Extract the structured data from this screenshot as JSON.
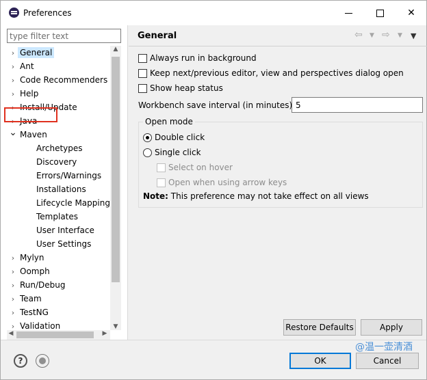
{
  "window": {
    "title": "Preferences"
  },
  "filter": {
    "placeholder": "type filter text"
  },
  "tree": {
    "items": [
      {
        "label": "General",
        "level": 0,
        "state": "collapsed",
        "selected": true
      },
      {
        "label": "Ant",
        "level": 0,
        "state": "collapsed"
      },
      {
        "label": "Code Recommenders",
        "level": 0,
        "state": "collapsed"
      },
      {
        "label": "Help",
        "level": 0,
        "state": "collapsed"
      },
      {
        "label": "Install/Update",
        "level": 0,
        "state": "collapsed"
      },
      {
        "label": "Java",
        "level": 0,
        "state": "collapsed"
      },
      {
        "label": "Maven",
        "level": 0,
        "state": "expanded",
        "highlighted": true
      },
      {
        "label": "Archetypes",
        "level": 1
      },
      {
        "label": "Discovery",
        "level": 1
      },
      {
        "label": "Errors/Warnings",
        "level": 1
      },
      {
        "label": "Installations",
        "level": 1
      },
      {
        "label": "Lifecycle Mapping",
        "level": 1
      },
      {
        "label": "Templates",
        "level": 1
      },
      {
        "label": "User Interface",
        "level": 1
      },
      {
        "label": "User Settings",
        "level": 1
      },
      {
        "label": "Mylyn",
        "level": 0,
        "state": "collapsed"
      },
      {
        "label": "Oomph",
        "level": 0,
        "state": "collapsed"
      },
      {
        "label": "Run/Debug",
        "level": 0,
        "state": "collapsed"
      },
      {
        "label": "Team",
        "level": 0,
        "state": "collapsed"
      },
      {
        "label": "TestNG",
        "level": 0,
        "state": "collapsed"
      },
      {
        "label": "Validation",
        "level": 0,
        "state": "collapsed"
      }
    ]
  },
  "page": {
    "title": "General",
    "options": {
      "always_run_bg": "Always run in background",
      "keep_next_prev": "Keep next/previous editor, view and perspectives dialog open",
      "show_heap": "Show heap status"
    },
    "interval": {
      "label": "Workbench save interval (in minutes):",
      "value": "5"
    },
    "open_mode": {
      "title": "Open mode",
      "double_click": "Double click",
      "single_click": "Single click",
      "select_on_hover": "Select on hover",
      "open_arrow_keys": "Open when using arrow keys",
      "note_bold": "Note:",
      "note_text": " This preference may not take effect on all views"
    },
    "restore_defaults": "Restore Defaults",
    "apply": "Apply"
  },
  "footer": {
    "ok": "OK",
    "cancel": "Cancel",
    "watermark": "@温一壶清酒"
  },
  "colors": {
    "selection": "#cce8ff",
    "highlight_box": "#e0301e",
    "default_button": "#0078d7"
  },
  "icons": [
    "eclipse-app-icon",
    "minimize-icon",
    "maximize-icon",
    "close-icon",
    "chevron-right-icon",
    "chevron-down-icon",
    "back-arrow-icon",
    "forward-arrow-icon",
    "view-menu-icon",
    "help-icon",
    "record-icon"
  ]
}
